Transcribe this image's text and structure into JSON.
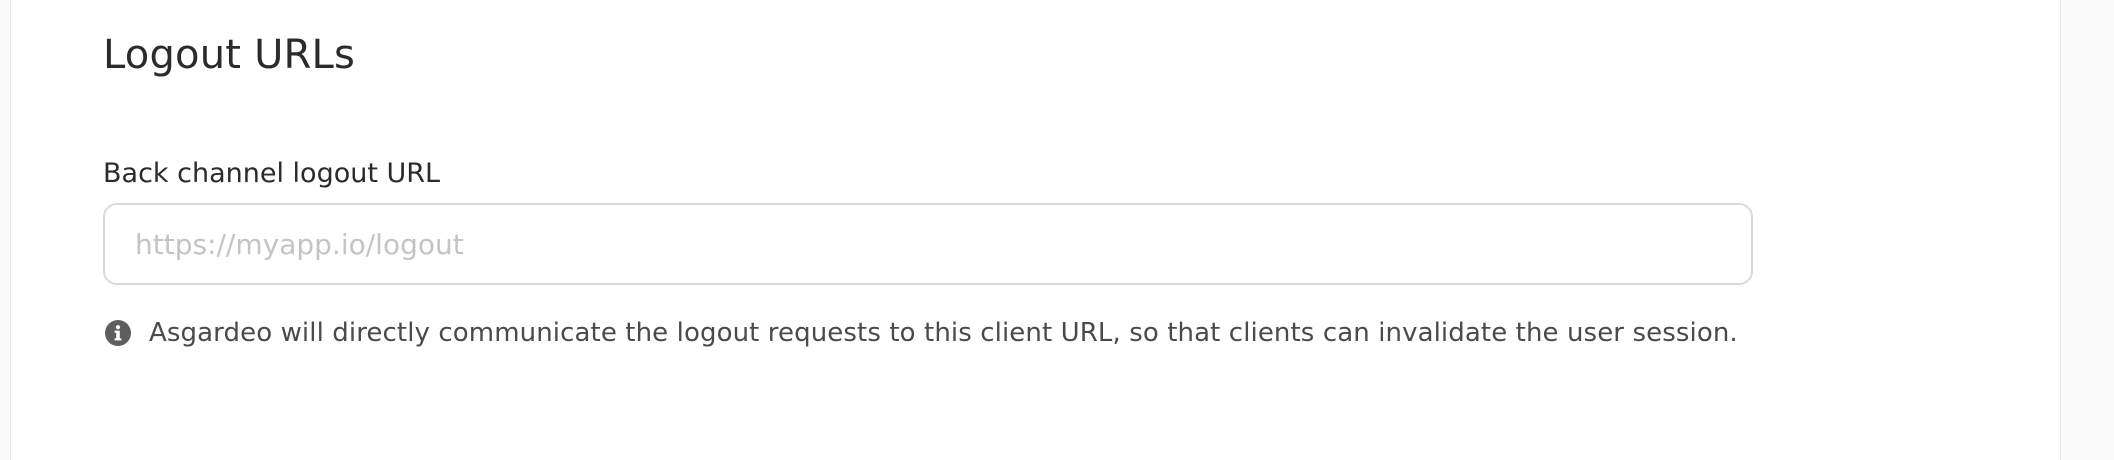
{
  "section": {
    "title": "Logout URLs"
  },
  "back_channel_logout": {
    "label": "Back channel logout URL",
    "value": "",
    "placeholder": "https://myapp.io/logout",
    "hint": "Asgardeo will directly communicate the logout requests to this client URL, so that clients can invalidate the user session.",
    "hint_icon": "info-icon"
  },
  "colors": {
    "text": "#2b2b2b",
    "placeholder": "#c4c4c4",
    "input_border": "#d9d9d9",
    "icon": "#5e5e5e"
  }
}
